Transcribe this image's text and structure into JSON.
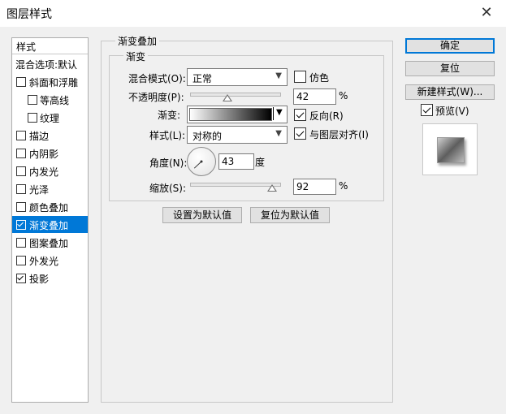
{
  "window": {
    "title": "图层样式",
    "close_icon": "close-icon"
  },
  "styles_panel": {
    "header": "样式",
    "items": [
      {
        "label": "混合选项:默认",
        "has_checkbox": false,
        "checked": false,
        "selected": false,
        "indent": false
      },
      {
        "label": "斜面和浮雕",
        "has_checkbox": true,
        "checked": false,
        "selected": false,
        "indent": false
      },
      {
        "label": "等高线",
        "has_checkbox": true,
        "checked": false,
        "selected": false,
        "indent": true
      },
      {
        "label": "纹理",
        "has_checkbox": true,
        "checked": false,
        "selected": false,
        "indent": true
      },
      {
        "label": "描边",
        "has_checkbox": true,
        "checked": false,
        "selected": false,
        "indent": false
      },
      {
        "label": "内阴影",
        "has_checkbox": true,
        "checked": false,
        "selected": false,
        "indent": false
      },
      {
        "label": "内发光",
        "has_checkbox": true,
        "checked": false,
        "selected": false,
        "indent": false
      },
      {
        "label": "光泽",
        "has_checkbox": true,
        "checked": false,
        "selected": false,
        "indent": false
      },
      {
        "label": "颜色叠加",
        "has_checkbox": true,
        "checked": false,
        "selected": false,
        "indent": false
      },
      {
        "label": "渐变叠加",
        "has_checkbox": true,
        "checked": true,
        "selected": true,
        "indent": false
      },
      {
        "label": "图案叠加",
        "has_checkbox": true,
        "checked": false,
        "selected": false,
        "indent": false
      },
      {
        "label": "外发光",
        "has_checkbox": true,
        "checked": false,
        "selected": false,
        "indent": false
      },
      {
        "label": "投影",
        "has_checkbox": true,
        "checked": true,
        "selected": false,
        "indent": false
      }
    ]
  },
  "gradient_overlay": {
    "section_title": "渐变叠加",
    "group_title": "渐变",
    "blend_mode": {
      "label": "混合模式(O):",
      "value": "正常"
    },
    "dither": {
      "label": "仿色",
      "checked": false
    },
    "opacity": {
      "label": "不透明度(P):",
      "value": "42",
      "unit": "%",
      "level": 0.42
    },
    "gradient": {
      "label": "渐变:",
      "reverse_label": "反向(R)",
      "reverse_checked": true
    },
    "style": {
      "label": "样式(L):",
      "value": "对称的",
      "align_label": "与图层对齐(I)",
      "align_checked": true
    },
    "angle": {
      "label": "角度(N):",
      "value": "43",
      "unit": "度",
      "degrees": 43
    },
    "scale": {
      "label": "缩放(S):",
      "value": "92",
      "unit": "%",
      "level": 0.92
    },
    "set_default_button": "设置为默认值",
    "reset_default_button": "复位为默认值"
  },
  "right_panel": {
    "ok_button": "确定",
    "reset_button": "复位",
    "new_style_button": "新建样式(W)...",
    "preview": {
      "label": "预览(V)",
      "checked": true
    }
  },
  "colors": {
    "selection": "#0078d7",
    "dialog_bg": "#f0f0f0"
  }
}
